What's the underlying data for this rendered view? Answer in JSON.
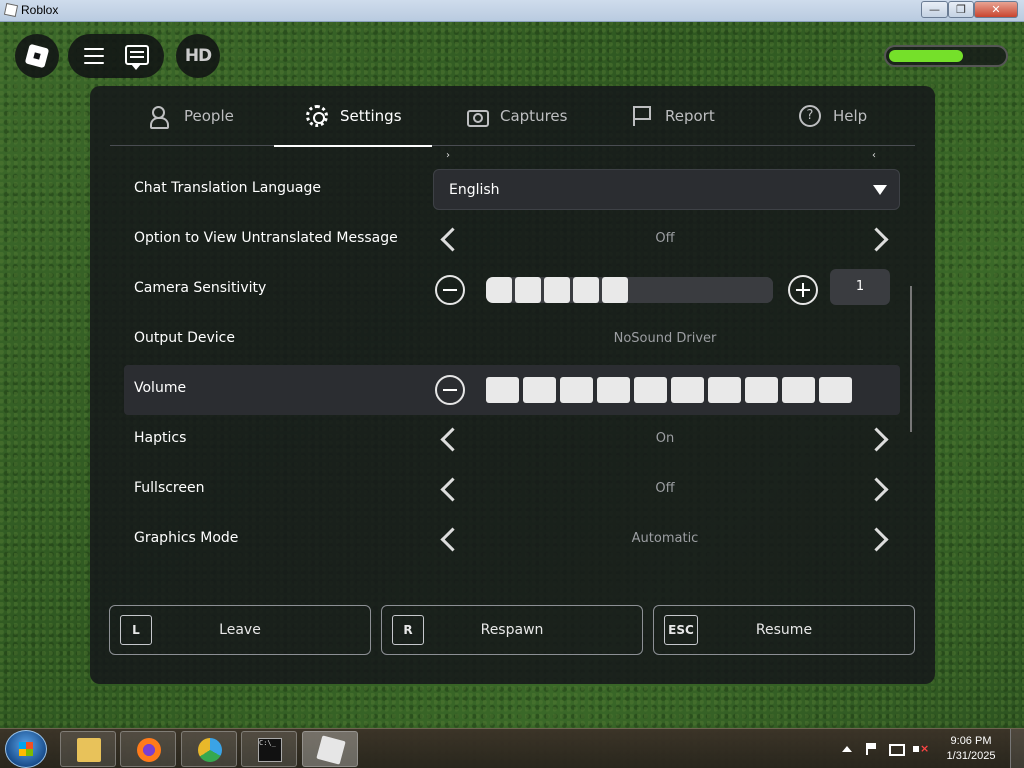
{
  "window": {
    "title": "Roblox",
    "min": "—",
    "max": "❐",
    "close": "✕"
  },
  "hud": {
    "hd_label": "HD",
    "health_fraction": 0.65
  },
  "tabs": [
    {
      "label": "People",
      "icon": "people-icon"
    },
    {
      "label": "Settings",
      "icon": "gear-icon",
      "active": true
    },
    {
      "label": "Captures",
      "icon": "camera-icon"
    },
    {
      "label": "Report",
      "icon": "flag-icon"
    },
    {
      "label": "Help",
      "icon": "help-icon"
    }
  ],
  "settings": {
    "chat_translation": {
      "label": "Chat Translation Language",
      "value": "English"
    },
    "untranslated": {
      "label": "Option to View Untranslated Message",
      "value": "Off"
    },
    "camera": {
      "label": "Camera Sensitivity",
      "value": "1",
      "level": 5,
      "segments": 10
    },
    "output": {
      "label": "Output Device",
      "value": "NoSound Driver"
    },
    "volume": {
      "label": "Volume",
      "level": 10,
      "segments": 10
    },
    "haptics": {
      "label": "Haptics",
      "value": "On"
    },
    "fullscreen": {
      "label": "Fullscreen",
      "value": "Off"
    },
    "graphics": {
      "label": "Graphics Mode",
      "value": "Automatic"
    }
  },
  "actions": {
    "leave": {
      "key": "L",
      "label": "Leave"
    },
    "respawn": {
      "key": "R",
      "label": "Respawn"
    },
    "resume": {
      "key": "ESC",
      "label": "Resume"
    }
  },
  "taskbar": {
    "cmd_glyph": "C:\\_",
    "time": "9:06 PM",
    "date": "1/31/2025"
  },
  "colors": {
    "health": "#75e02a",
    "panel": "#16181a",
    "text": "#ffffff"
  }
}
